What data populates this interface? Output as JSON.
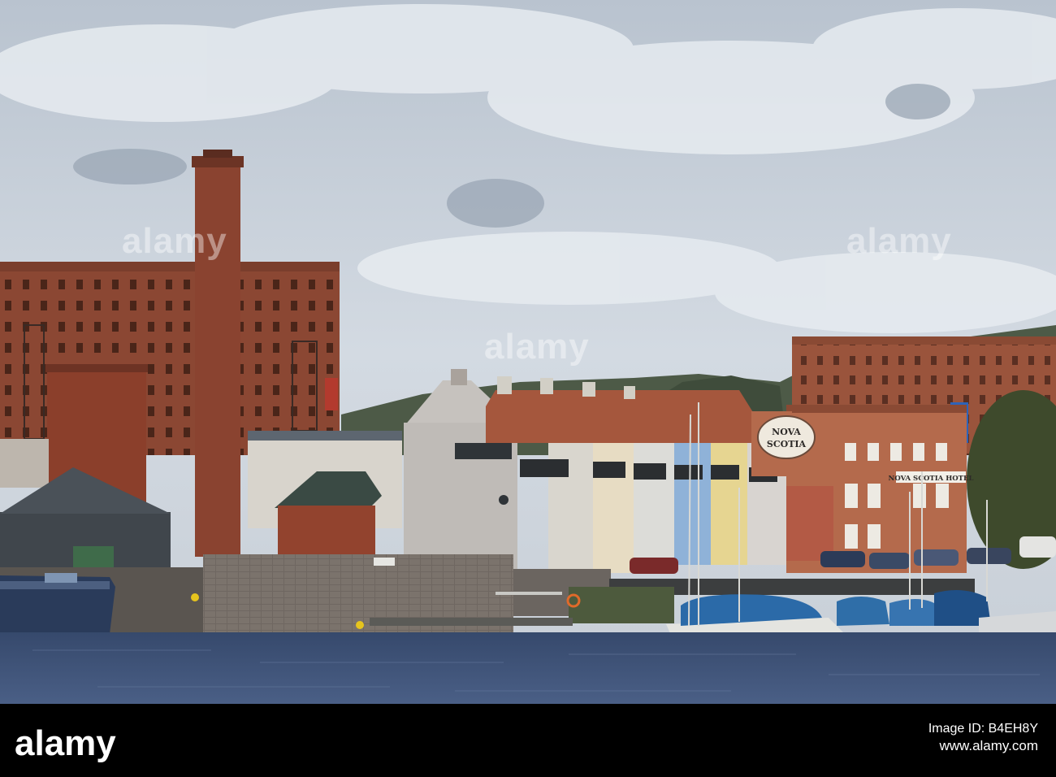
{
  "photo": {
    "sign_line_1": "NOVA",
    "sign_line_2": "SCOTIA",
    "hotel_sign": "NOVA SCOTIA HOTEL"
  },
  "watermarks": [
    "alamy",
    "alamy",
    "alamy"
  ],
  "footer": {
    "logo": "alamy",
    "image_id_label": "Image ID: B4EH8Y",
    "url": "www.alamy.com"
  },
  "colors": {
    "sky": "#c9d2dc",
    "brick": "#8a4a36",
    "water": "#3f5478",
    "boat_cover": "#2b6aa8"
  }
}
